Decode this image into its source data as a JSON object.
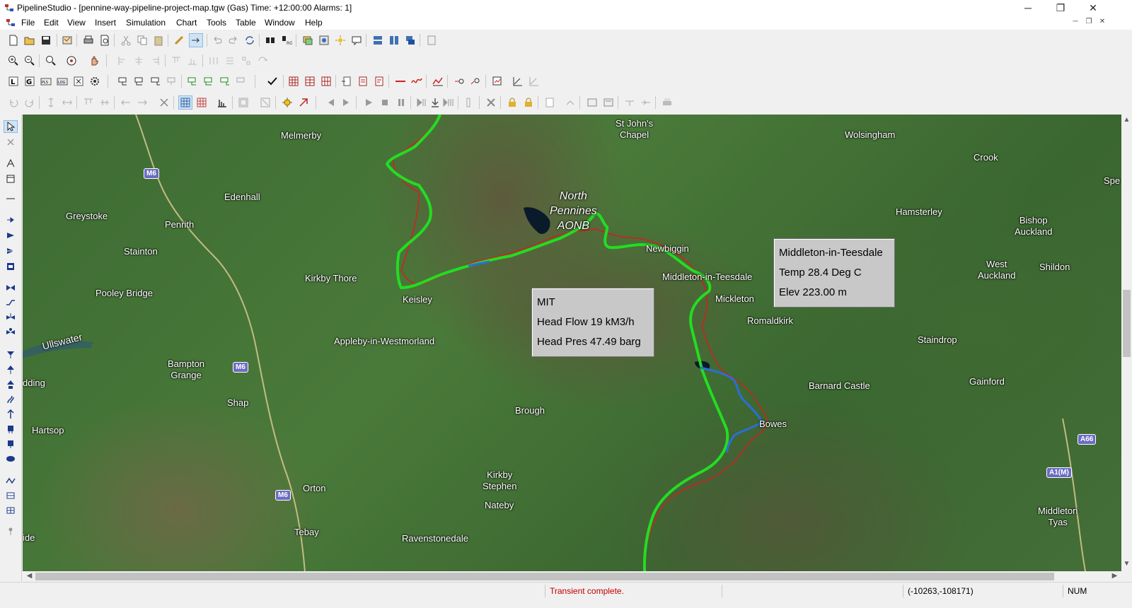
{
  "window": {
    "title": "PipelineStudio - [pennine-way-pipeline-project-map.tgw (Gas) Time: +12:00:00 Alarms: 1]",
    "minimize": "─",
    "restore": "❐",
    "close": "✕"
  },
  "menu": {
    "items": [
      "File",
      "Edit",
      "View",
      "Insert",
      "Simulation",
      "Chart",
      "Tools",
      "Table",
      "Window",
      "Help"
    ],
    "mdi_minimize": "─",
    "mdi_restore": "❐",
    "mdi_close": "✕"
  },
  "map": {
    "places": [
      "Melmerby",
      "St John's\nChapel",
      "Wolsingham",
      "Crook",
      "Edenhall",
      "Greystoke",
      "Penrith",
      "Hamsterley",
      "Bishop\nAuckland",
      "Stainton",
      "Newbiggin",
      "Kirkby Thore",
      "Middleton-in-Teesdale",
      "West\nAuckland",
      "Shildon",
      "Pooley Bridge",
      "Keisley",
      "Mickleton",
      "Romaldkirk",
      "Ullswater",
      "Appleby-in-Westmorland",
      "Staindrop",
      "Bampton\nGrange",
      "Barnard Castle",
      "Gainford",
      "Shap",
      "Brough",
      "Bowes",
      "Hartsop",
      "Orton",
      "Kirkby\nStephen",
      "Nateby",
      "Middleton\nTyas",
      "Tebay",
      "Ravenstonedale",
      "dding",
      "ide",
      "Spe"
    ],
    "aonb_label": "North\nPennines\nAONB",
    "roads": [
      "M6",
      "M6",
      "M6",
      "A66",
      "A1(M)"
    ],
    "route_colors": {
      "main": "#22dd22",
      "branch": "#2a6fd6",
      "profile": "#d02020"
    }
  },
  "tooltips": {
    "middleton": {
      "name": "Middleton-in-Teesdale",
      "temp": "Temp 28.4 Deg C",
      "elev": "Elev 223.00 m"
    },
    "mit": {
      "name": "MIT",
      "flow": "Head Flow 19 kM3/h",
      "pres": "Head Pres 47.49 barg"
    }
  },
  "status": {
    "message": "Transient complete.",
    "coords": "(-10263,-108171)",
    "num": "NUM",
    "message_color": "#c00000"
  }
}
